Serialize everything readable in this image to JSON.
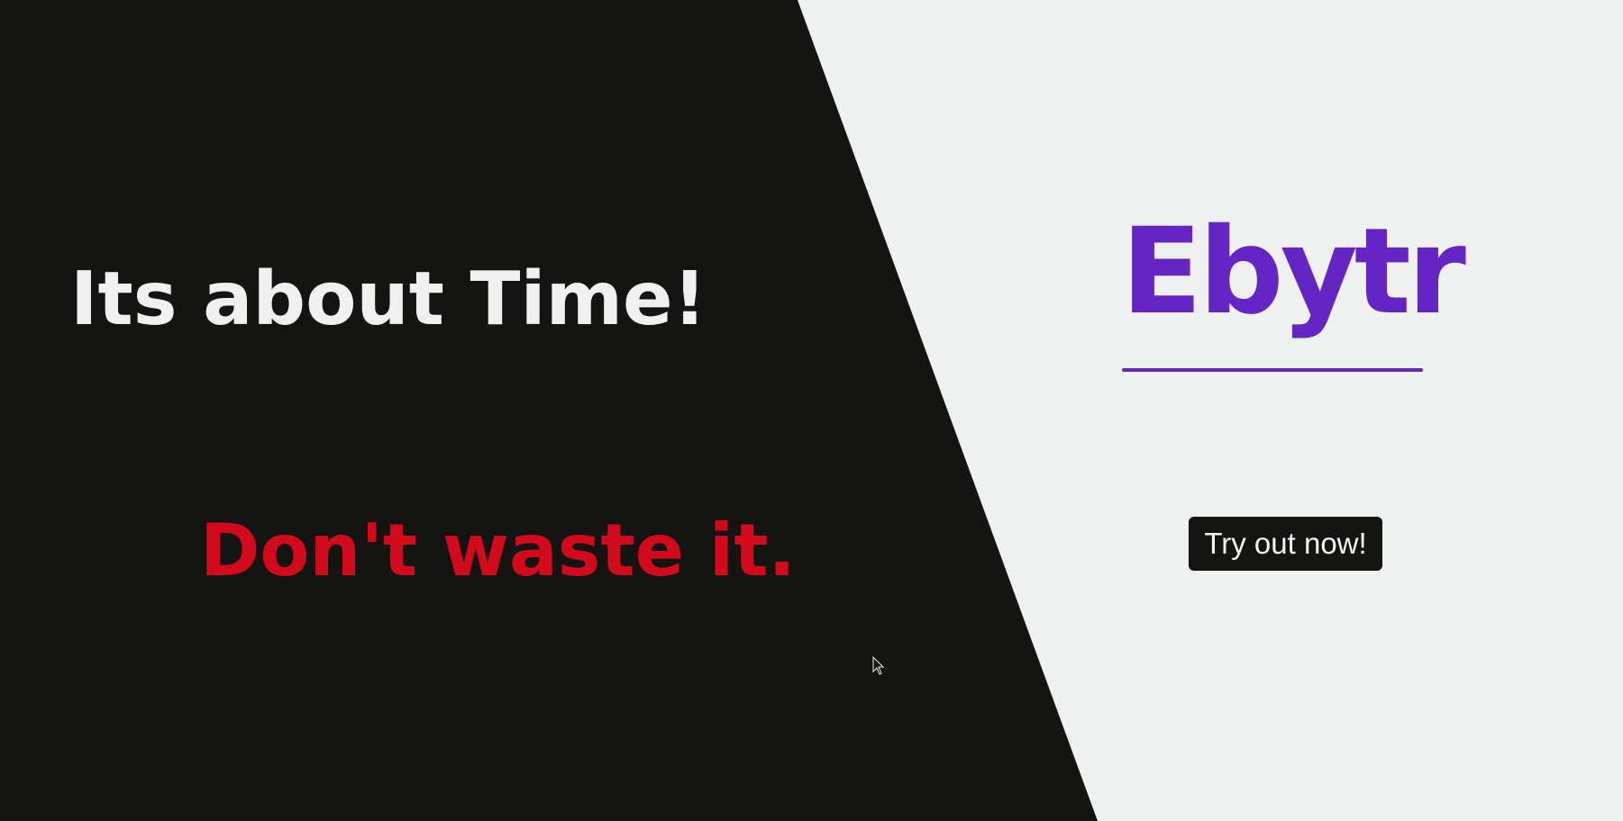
{
  "hero": {
    "headline": "Its about Time!",
    "tagline": "Don't waste it."
  },
  "brand": {
    "name": "Ebytr"
  },
  "cta": {
    "label": "Try out now!"
  },
  "colors": {
    "dark_background": "#141412",
    "light_background": "#eff0f0",
    "brand_purple": "#6524c4",
    "tagline_red": "#d20a1b",
    "headline_white": "#f0f0f0"
  },
  "icons": {
    "pointer": "mouse-pointer-icon"
  }
}
